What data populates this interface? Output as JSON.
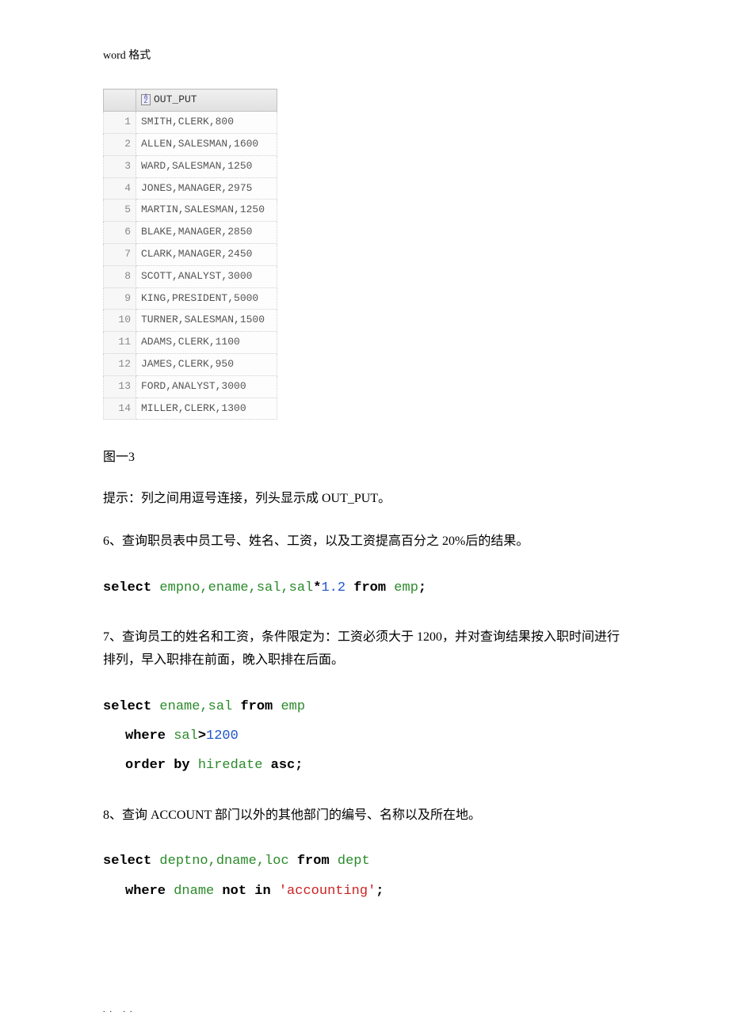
{
  "header": "word 格式",
  "table": {
    "column_header": "OUT_PUT",
    "rows": [
      "SMITH,CLERK,800",
      "ALLEN,SALESMAN,1600",
      "WARD,SALESMAN,1250",
      "JONES,MANAGER,2975",
      "MARTIN,SALESMAN,1250",
      "BLAKE,MANAGER,2850",
      "CLARK,MANAGER,2450",
      "SCOTT,ANALYST,3000",
      "KING,PRESIDENT,5000",
      "TURNER,SALESMAN,1500",
      "ADAMS,CLERK,1100",
      "JAMES,CLERK,950",
      "FORD,ANALYST,3000",
      "MILLER,CLERK,1300"
    ]
  },
  "figure_label": "图一3",
  "hint": "提示：列之间用逗号连接，列头显示成 OUT_PUT。",
  "q6": "6、查询职员表中员工号、姓名、工资，以及工资提高百分之 20%后的结果。",
  "code6": {
    "select": "select",
    "cols": " empno,ename,sal,sal",
    "star": "*",
    "num": "1.2",
    "from": " from",
    "tbl": " emp",
    "semi": ";"
  },
  "q7": "7、查询员工的姓名和工资，条件限定为：工资必须大于 1200，并对查询结果按入职时间进行排列，早入职排在前面，晚入职排在后面。",
  "code7": {
    "line1": {
      "select": "select",
      "cols": " ename,sal",
      "from": " from",
      "tbl": " emp"
    },
    "line2": {
      "where": "where",
      "col": " sal",
      "gt": ">",
      "num": "1200"
    },
    "line3": {
      "orderby": "order by",
      "col": " hiredate",
      "asc": " asc",
      "semi": ";"
    }
  },
  "q8": "8、查询 ACCOUNT 部门以外的其他部门的编号、名称以及所在地。",
  "code8": {
    "line1": {
      "select": "select",
      "cols": " deptno,dname,loc",
      "from": " from",
      "tbl": " dept"
    },
    "line2": {
      "where": "where",
      "col": " dname",
      "notin": " not in",
      "str": " 'accounting'",
      "semi": ";"
    }
  },
  "footer": ".. .."
}
